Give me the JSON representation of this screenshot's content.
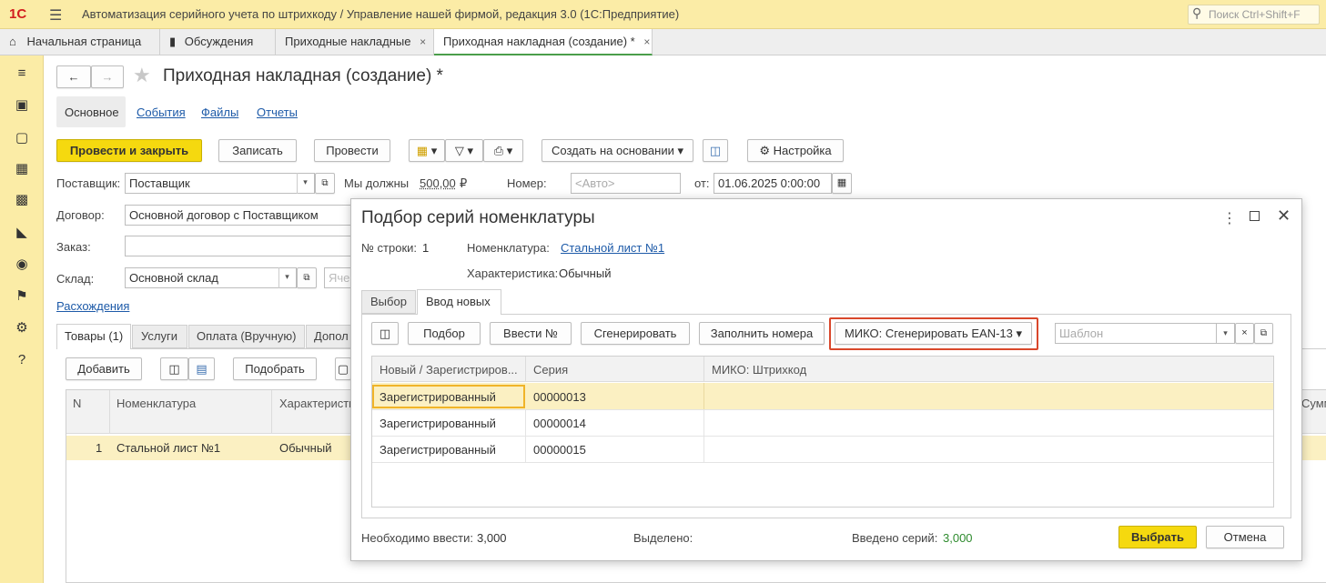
{
  "app": {
    "logo": "1С",
    "title": "Автоматизация серийного учета по штрихкоду / Управление нашей фирмой, редакция 3.0  (1С:Предприятие)",
    "search_placeholder": "Поиск Ctrl+Shift+F"
  },
  "tabs": [
    {
      "label": "Начальная страница"
    },
    {
      "label": "Обсуждения"
    },
    {
      "label": "Приходные накладные",
      "close": "×"
    },
    {
      "label": "Приходная накладная (создание) *",
      "close": "×"
    }
  ],
  "doc": {
    "title": "Приходная накладная (создание) *",
    "nav_tabs": [
      "Основное",
      "События",
      "Файлы",
      "Отчеты"
    ],
    "toolbar": {
      "post_close": "Провести и закрыть",
      "save": "Записать",
      "post": "Провести",
      "create_based": "Создать на основании",
      "settings": "Настройка"
    },
    "fields": {
      "supplier_label": "Поставщик:",
      "supplier_value": "Поставщик",
      "we_owe_label": "Мы должны",
      "we_owe_value": "500,00",
      "currency": "₽",
      "number_label": "Номер:",
      "number_placeholder": "<Авто>",
      "date_label": "от:",
      "date_value": "01.06.2025  0:00:00",
      "contract_label": "Договор:",
      "contract_value": "Основной договор с Поставщиком",
      "order_label": "Заказ:",
      "warehouse_label": "Склад:",
      "warehouse_value": "Основной склад",
      "extra_placeholder": "Яче",
      "expenses_link": "Расхождения"
    },
    "sub_tabs": [
      "Товары (1)",
      "Услуги",
      "Оплата (Вручную)",
      "Допол"
    ],
    "table_toolbar": {
      "add": "Добавить",
      "pick": "Подобрать"
    },
    "table": {
      "headers": [
        "N",
        "Номенклатура",
        "Характеристи"
      ],
      "right_header": "Сумм",
      "rows": [
        {
          "n": "1",
          "item": "Стальной лист №1",
          "char": "Обычный"
        }
      ]
    }
  },
  "modal": {
    "title": "Подбор серий номенклатуры",
    "row_label": "№ строки:",
    "row_value": "1",
    "nomen_label": "Номенклатура:",
    "nomen_value": "Стальной лист №1",
    "char_label": "Характеристика:",
    "char_value": "Обычный",
    "tabs": [
      "Выбор",
      "Ввод новых"
    ],
    "toolbar": {
      "pick": "Подбор",
      "enter_no": "Ввести №",
      "generate": "Сгенерировать",
      "fill_numbers": "Заполнить номера",
      "miko_generate": "МИКО: Сгенерировать EAN-13",
      "template_placeholder": "Шаблон"
    },
    "columns": [
      "Новый / Зарегистриров...",
      "Серия",
      "МИКО: Штрихкод"
    ],
    "rows": [
      {
        "status": "Зарегистрированный",
        "series": "00000013",
        "barcode": ""
      },
      {
        "status": "Зарегистрированный",
        "series": "00000014",
        "barcode": ""
      },
      {
        "status": "Зарегистрированный",
        "series": "00000015",
        "barcode": ""
      }
    ],
    "footer": {
      "need_label": "Необходимо ввести:",
      "need_value": "3,000",
      "selected_label": "Выделено:",
      "entered_label": "Введено серий:",
      "entered_value": "3,000",
      "ok": "Выбрать",
      "cancel": "Отмена"
    }
  },
  "colors": {
    "accent_yellow": "#f5d90f",
    "highlight": "#d9472b",
    "row_selected": "#fbf0c2",
    "green_value": "#2e8b2e"
  }
}
